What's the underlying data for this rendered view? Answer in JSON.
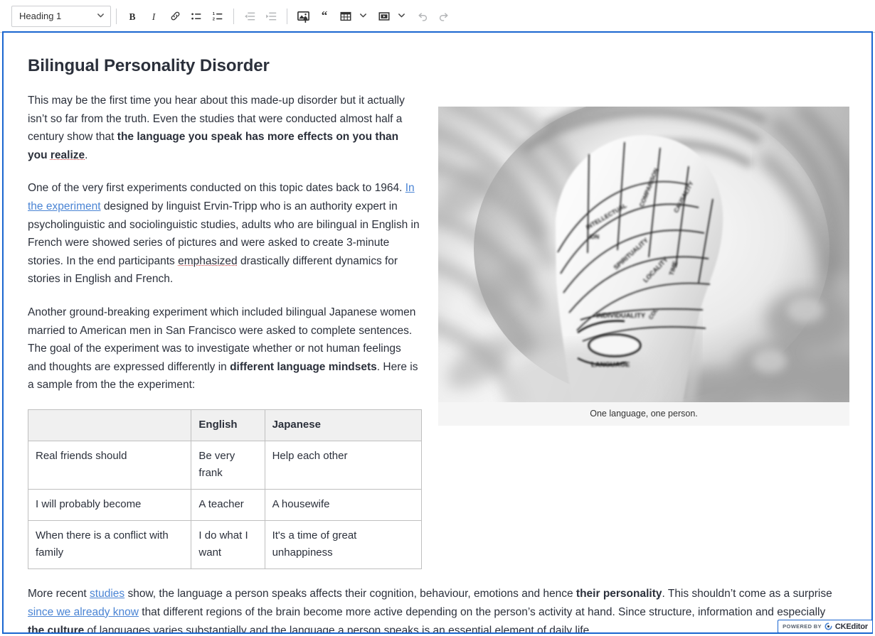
{
  "toolbar": {
    "heading_select": {
      "value": "Heading 1",
      "chevron": "chevron-down-icon"
    },
    "buttons": [
      {
        "name": "bold",
        "label": "B",
        "icon": "bold-icon"
      },
      {
        "name": "italic",
        "label": "I",
        "icon": "italic-icon"
      },
      {
        "name": "link",
        "label": "",
        "icon": "link-icon"
      },
      {
        "name": "bulleted-list",
        "label": "",
        "icon": "bulleted-list-icon"
      },
      {
        "name": "numbered-list",
        "label": "",
        "icon": "numbered-list-icon"
      },
      {
        "name": "decrease-indent",
        "label": "",
        "icon": "outdent-icon"
      },
      {
        "name": "increase-indent",
        "label": "",
        "icon": "indent-icon"
      },
      {
        "name": "insert-image",
        "label": "",
        "icon": "image-upload-icon"
      },
      {
        "name": "block-quote",
        "label": "",
        "icon": "blockquote-icon"
      },
      {
        "name": "insert-table",
        "label": "",
        "icon": "table-icon"
      },
      {
        "name": "insert-media",
        "label": "",
        "icon": "media-icon"
      },
      {
        "name": "undo",
        "label": "",
        "icon": "undo-icon"
      },
      {
        "name": "redo",
        "label": "",
        "icon": "redo-icon"
      }
    ]
  },
  "document": {
    "title": "Bilingual Personality Disorder",
    "paragraph1": {
      "part1": "This may be the first time you hear about this made-up disorder but it actually isn’t so far from the truth. Even the studies that were conducted almost half a century show that ",
      "bold1": "the language you speak has more effects on you than you ",
      "bold1_misspelled": "realize",
      "part2": "."
    },
    "paragraph2": {
      "part1": "One of the very first experiments conducted on this topic dates back to 1964. ",
      "link1": "In the experiment",
      "part2": " designed by linguist Ervin-Tripp who is an authority expert in psycholinguistic and sociolinguistic studies, adults who are bilingual in English in French were showed series of pictures and were asked to create 3-minute stories. In the end participants ",
      "misspelled": "emphasized",
      "part3": " drastically different dynamics for stories in English and French."
    },
    "paragraph3": {
      "part1": "Another ground-breaking experiment which included bilingual Japanese women married to American men in San Francisco were asked to complete sentences. The goal of the experiment was to investigate whether or not human feelings and thoughts are expressed differently in ",
      "bold1": "different language mindsets",
      "part2": ". Here is a sample from the the experiment:"
    },
    "paragraph4": {
      "part1": "More recent ",
      "link1": "studies",
      "part2": " show, the language a person speaks affects their cognition, behaviour, emotions and hence ",
      "bold1": "their personality",
      "part3": ". This shouldn’t come as a surprise ",
      "link2": "since we already know",
      "part4": " that different regions of the brain become more active depending on the person’s activity at hand. Since structure, information and especially ",
      "bold2": "the culture",
      "part5": " of languages varies substantially and the language a person speaks is an essential element of daily life."
    },
    "table": {
      "headers": [
        "",
        "English",
        "Japanese"
      ],
      "rows": [
        [
          "Real friends should",
          "Be very frank",
          "Help each other"
        ],
        [
          "I will probably become",
          "A teacher",
          "A housewife"
        ],
        [
          "When there is a conflict with family",
          "I do what I want",
          "It's a time of great unhappiness"
        ]
      ]
    },
    "figure": {
      "caption": "One language, one person.",
      "alt": "Grayscale photograph of a porcelain phrenology head with labelled brain regions seen through a blurred frame",
      "phrenology_labels": [
        "INTELLECTUAL",
        "COMPARISON",
        "CAUSALITY",
        "SPIRITUALITY",
        "LOCALITY",
        "TIME",
        "COLOUR",
        "INDIVIDUALITY",
        "LANGUAGE"
      ]
    }
  },
  "badge": {
    "powered_by": "POWERED BY",
    "product": "CKEditor",
    "logo": "ckeditor-logo-icon"
  },
  "colors": {
    "text": "#2b303b",
    "link": "#4a84d4",
    "focus_border": "#1a66d0",
    "toolbar_border": "#ccced1",
    "table_header_bg": "#f0f0f0",
    "caption_bg": "#f5f5f5",
    "spellcheck": "#d03b3b"
  }
}
